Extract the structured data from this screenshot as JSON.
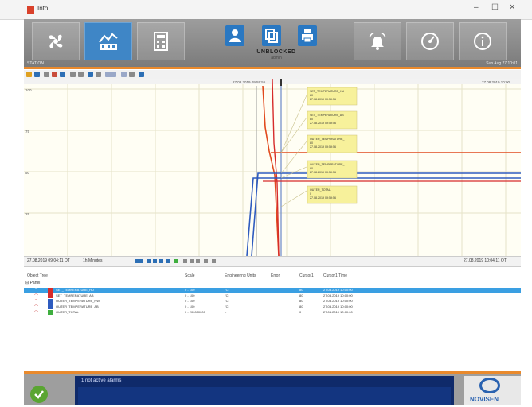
{
  "window": {
    "title": "Info",
    "buttons": {
      "minimize": "–",
      "maximize": "☐",
      "close": "✕"
    }
  },
  "header": {
    "status": "UNBLOCKED",
    "status_sub": "admin",
    "station": "STATION",
    "datetime": "Sun Aug 27 10:01"
  },
  "icons": {
    "app": "app-logo-icon",
    "tab1": "fan-icon",
    "tab2": "factory-chart-icon",
    "tab3": "calculator-icon",
    "user1": "user-icon",
    "user2": "copy-icon",
    "user3": "printer-icon",
    "r1": "alarm-bell-icon",
    "r2": "speedometer-icon",
    "r3": "info-icon"
  },
  "axis": {
    "start": "27.08.2019 09:04:11 OT",
    "zoom": "1h Minutes",
    "end": "27.08.2019 10:04:11 OT"
  },
  "chart": {
    "top_label": "27.08.2019 09:59:56",
    "right_label": "27.08.2019 10:00",
    "y_ticks": [
      "100",
      "75",
      "50",
      "25"
    ],
    "callouts": [
      {
        "line1": "SET_TEMPERATURE_HU",
        "line2": "80",
        "line3": "27.08.2019 09:59:56"
      },
      {
        "line1": "SET_TEMPERATURE_AB",
        "line2": "80",
        "line3": "27.08.2019 09:59:56"
      },
      {
        "line1": "OUTER_TEMPERATURE_",
        "line2": "80",
        "line3": "27.08.2019 09:59:56"
      },
      {
        "line1": "OUTER_TEMPERATURE_",
        "line2": "80",
        "line3": "27.08.2019 09:59:56"
      },
      {
        "line1": "OUTER_TOTAL",
        "line2": "0",
        "line3": "27.08.2019 09:59:56"
      }
    ]
  },
  "grid": {
    "headers": [
      "Object Tree",
      "Scale",
      "Engineering Units",
      "Error",
      "Cursor1",
      "Cursor1 Time"
    ],
    "tree_root": "Panel",
    "rows": [
      {
        "name": "SET_TEMPERATURE_HU",
        "scale": "0 - 100",
        "units": "°C",
        "error": "",
        "cursor": "80",
        "time": "27.08.2019 10:00:00",
        "color": "#d62b2b"
      },
      {
        "name": "SET_TEMPERATURE_AB",
        "scale": "0 - 100",
        "units": "°C",
        "error": "",
        "cursor": "80",
        "time": "27.08.2019 10:00:00",
        "color": "#d62b2b"
      },
      {
        "name": "OUTER_TEMPERATURE_HW",
        "scale": "0 - 100",
        "units": "°C",
        "error": "",
        "cursor": "80",
        "time": "27.08.2019 10:00:00",
        "color": "#2e5bbf"
      },
      {
        "name": "OUTER_TEMPERATURE_AB",
        "scale": "0 - 100",
        "units": "°C",
        "error": "",
        "cursor": "80",
        "time": "27.08.2019 10:00:00",
        "color": "#2e5bbf"
      },
      {
        "name": "OUTER_TOTAL",
        "scale": "0 - 200000000",
        "units": "L",
        "error": "",
        "cursor": "0",
        "time": "27.08.2019 10:00:00",
        "color": "#3fae3f"
      }
    ]
  },
  "footer": {
    "alarm_title": "1 not active alarms",
    "brand": "NOVISEN"
  }
}
